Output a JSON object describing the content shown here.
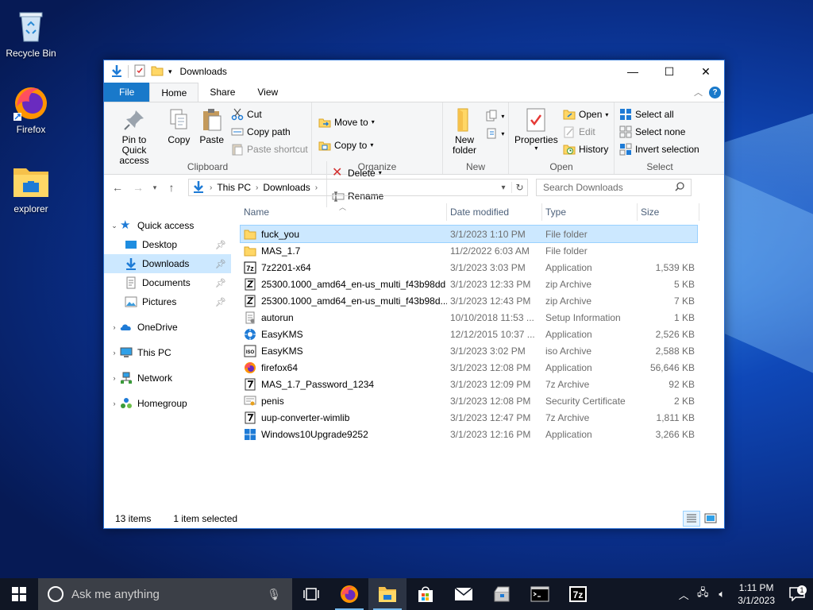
{
  "desktop": {
    "icons": [
      {
        "label": "Recycle Bin",
        "icon": "recycle-bin-icon"
      },
      {
        "label": "Firefox",
        "icon": "firefox-icon"
      },
      {
        "label": "explorer",
        "icon": "folder-icon"
      }
    ]
  },
  "window": {
    "title": "Downloads",
    "controls": {
      "minimize": "—",
      "maximize": "☐",
      "close": "✕"
    }
  },
  "ribbon": {
    "tabs": [
      "File",
      "Home",
      "Share",
      "View"
    ],
    "active_tab": "Home",
    "clipboard": {
      "pin": "Pin to Quick access",
      "copy": "Copy",
      "paste": "Paste",
      "cut": "Cut",
      "copy_path": "Copy path",
      "paste_shortcut": "Paste shortcut",
      "label": "Clipboard"
    },
    "organize": {
      "move_to": "Move to",
      "copy_to": "Copy to",
      "delete": "Delete",
      "rename": "Rename",
      "label": "Organize"
    },
    "new": {
      "new_folder": "New folder",
      "label": "New"
    },
    "open": {
      "properties": "Properties",
      "open": "Open",
      "edit": "Edit",
      "history": "History",
      "label": "Open"
    },
    "select": {
      "select_all": "Select all",
      "select_none": "Select none",
      "invert": "Invert selection",
      "label": "Select"
    }
  },
  "address": {
    "path": [
      "This PC",
      "Downloads"
    ],
    "search_placeholder": "Search Downloads"
  },
  "nav": {
    "quick_access": "Quick access",
    "pinned": [
      "Desktop",
      "Downloads",
      "Documents",
      "Pictures"
    ],
    "onedrive": "OneDrive",
    "this_pc": "This PC",
    "network": "Network",
    "homegroup": "Homegroup"
  },
  "columns": {
    "name": "Name",
    "date": "Date modified",
    "type": "Type",
    "size": "Size"
  },
  "files": [
    {
      "name": "fuck_you",
      "date": "3/1/2023 1:10 PM",
      "type": "File folder",
      "size": "",
      "icon": "folder"
    },
    {
      "name": "MAS_1.7",
      "date": "11/2/2022 6:03 AM",
      "type": "File folder",
      "size": "",
      "icon": "folder"
    },
    {
      "name": "7z2201-x64",
      "date": "3/1/2023 3:03 PM",
      "type": "Application",
      "size": "1,539 KB",
      "icon": "7z-app"
    },
    {
      "name": "25300.1000_amd64_en-us_multi_f43b98dd",
      "date": "3/1/2023 12:33 PM",
      "type": "zip Archive",
      "size": "5 KB",
      "icon": "zip"
    },
    {
      "name": "25300.1000_amd64_en-us_multi_f43b98d...",
      "date": "3/1/2023 12:43 PM",
      "type": "zip Archive",
      "size": "7 KB",
      "icon": "zip"
    },
    {
      "name": "autorun",
      "date": "10/10/2018 11:53 ...",
      "type": "Setup Information",
      "size": "1 KB",
      "icon": "inf"
    },
    {
      "name": "EasyKMS",
      "date": "12/12/2015 10:37 ...",
      "type": "Application",
      "size": "2,526 KB",
      "icon": "kms-app"
    },
    {
      "name": "EasyKMS",
      "date": "3/1/2023 3:02 PM",
      "type": "iso Archive",
      "size": "2,588 KB",
      "icon": "iso"
    },
    {
      "name": "firefox64",
      "date": "3/1/2023 12:08 PM",
      "type": "Application",
      "size": "56,646 KB",
      "icon": "firefox-app"
    },
    {
      "name": "MAS_1.7_Password_1234",
      "date": "3/1/2023 12:09 PM",
      "type": "7z Archive",
      "size": "92 KB",
      "icon": "7z"
    },
    {
      "name": "penis",
      "date": "3/1/2023 12:08 PM",
      "type": "Security Certificate",
      "size": "2 KB",
      "icon": "cert"
    },
    {
      "name": "uup-converter-wimlib",
      "date": "3/1/2023 12:47 PM",
      "type": "7z Archive",
      "size": "1,811 KB",
      "icon": "7z"
    },
    {
      "name": "Windows10Upgrade9252",
      "date": "3/1/2023 12:16 PM",
      "type": "Application",
      "size": "3,266 KB",
      "icon": "windows-app"
    }
  ],
  "status": {
    "items": "13 items",
    "selected": "1 item selected"
  },
  "taskbar": {
    "search_placeholder": "Ask me anything",
    "time": "1:11 PM",
    "date": "3/1/2023",
    "notifications": "1"
  }
}
